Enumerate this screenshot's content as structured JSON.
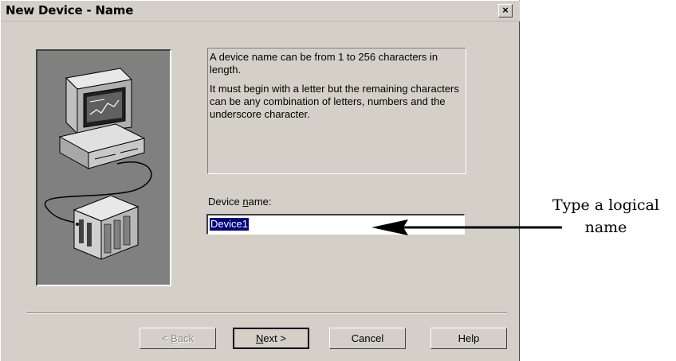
{
  "window": {
    "title": "New Device - Name",
    "close_glyph": "×"
  },
  "description": {
    "para1": "A device name can be from 1 to 256 characters in length.",
    "para2": "It must begin with a letter but the remaining characters can be any combination of letters, numbers and the underscore character."
  },
  "field": {
    "label_pre": "Device ",
    "label_mnemonic": "n",
    "label_post": "ame:",
    "value": "Device1"
  },
  "buttons": {
    "back_pre": "< ",
    "back_mnemonic": "B",
    "back_post": "ack",
    "next_mnemonic": "N",
    "next_post": "ext >",
    "cancel": "Cancel",
    "help": "Help"
  },
  "annotation": {
    "line1": "Type a logical",
    "line2": "name"
  },
  "icons": [
    "close-icon",
    "computer-illustration",
    "device-module-illustration",
    "annotation-arrow"
  ]
}
